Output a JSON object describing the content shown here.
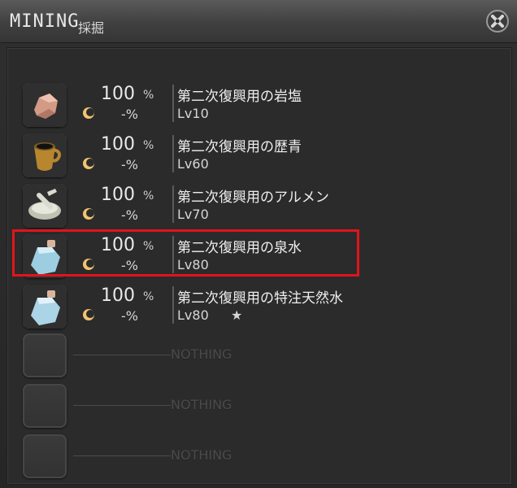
{
  "window": {
    "title": "MINING",
    "subtitle": "採掘"
  },
  "items": [
    {
      "icon": "rock-salt-icon",
      "success_rate": "100",
      "success_unit": "%",
      "hq_rate": "-%",
      "name": "第二次復興用の岩塩",
      "level": "Lv10",
      "star": ""
    },
    {
      "icon": "bitumen-pot-icon",
      "success_rate": "100",
      "success_unit": "%",
      "hq_rate": "-%",
      "name": "第二次復興用の歴青",
      "level": "Lv60",
      "star": ""
    },
    {
      "icon": "alumen-mortar-icon",
      "success_rate": "100",
      "success_unit": "%",
      "hq_rate": "-%",
      "name": "第二次復興用のアルメン",
      "level": "Lv70",
      "star": ""
    },
    {
      "icon": "spring-water-bottle-icon",
      "success_rate": "100",
      "success_unit": "%",
      "hq_rate": "-%",
      "name": "第二次復興用の泉水",
      "level": "Lv80",
      "star": ""
    },
    {
      "icon": "special-spring-water-bottle-icon",
      "success_rate": "100",
      "success_unit": "%",
      "hq_rate": "-%",
      "name": "第二次復興用の特注天然水",
      "level": "Lv80",
      "star": "★"
    }
  ],
  "empty_slots": [
    {
      "label": "NOTHING"
    },
    {
      "label": "NOTHING"
    },
    {
      "label": "NOTHING"
    }
  ],
  "highlight": {
    "color": "#e1141b",
    "selected_index": 3
  }
}
